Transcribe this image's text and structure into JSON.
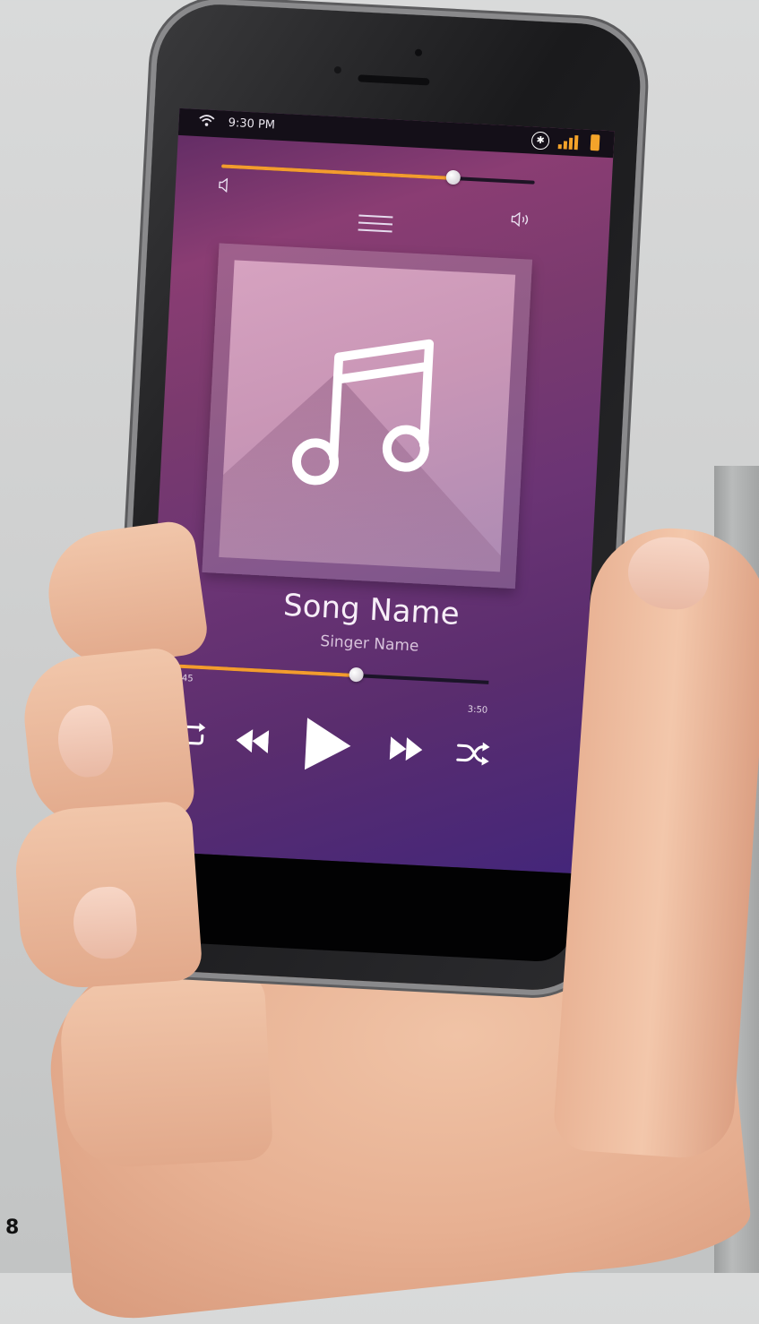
{
  "page_number": "8",
  "status_bar": {
    "time": "9:30 PM",
    "wifi_icon": "wifi-icon",
    "bluetooth_icon": "bluetooth-icon",
    "signal_icon": "signal-icon",
    "battery_icon": "battery-icon"
  },
  "volume": {
    "level": 0.74,
    "low_icon": "volume-low-icon",
    "high_icon": "volume-high-icon"
  },
  "menu_icon": "menu-icon",
  "album_art_icon": "music-note-icon",
  "song": {
    "title": "Song Name",
    "artist": "Singer Name"
  },
  "progress": {
    "elapsed": "2:45",
    "total": "3:50",
    "fraction": 0.58
  },
  "controls": {
    "repeat_icon": "repeat-icon",
    "rewind_icon": "rewind-icon",
    "play_icon": "play-icon",
    "fast_forward_icon": "fast-forward-icon",
    "shuffle_icon": "shuffle-icon"
  },
  "colors": {
    "accent": "#f39c2e",
    "background_top": "#8a3d73",
    "background_bottom": "#44267a"
  }
}
